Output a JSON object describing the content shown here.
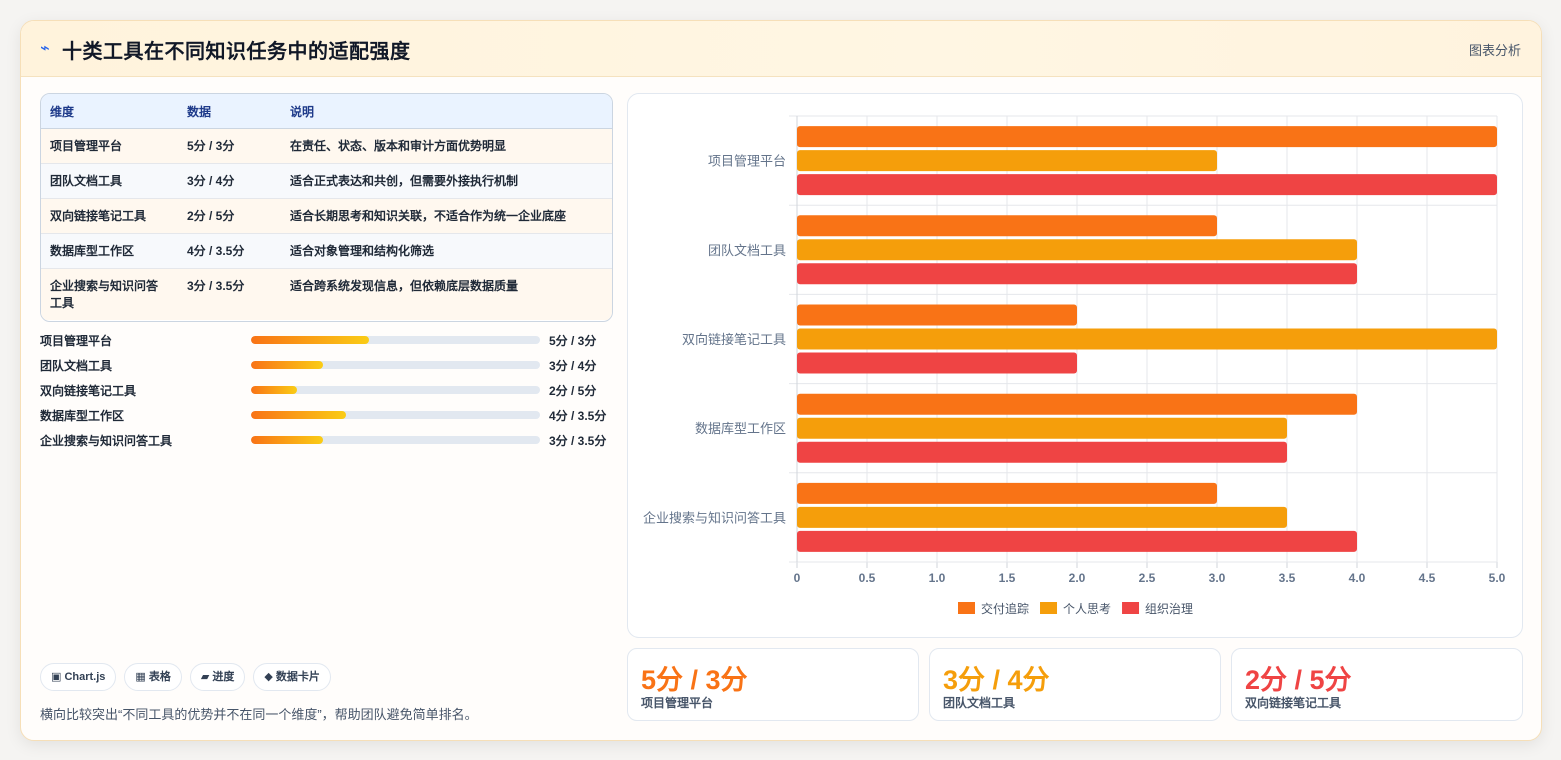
{
  "header": {
    "title_icon": "⌁",
    "title": "十类工具在不同知识任务中的适配强度",
    "action": "图表分析"
  },
  "table": {
    "headers": [
      "维度",
      "数据",
      "说明"
    ],
    "rows": [
      {
        "dimension": "项目管理平台",
        "data": "5分 / 3分",
        "note": "在责任、状态、版本和审计方面优势明显"
      },
      {
        "dimension": "团队文档工具",
        "data": "3分 / 4分",
        "note": "适合正式表达和共创，但需要外接执行机制"
      },
      {
        "dimension": "双向链接笔记工具",
        "data": "2分 / 5分",
        "note": "适合长期思考和知识关联，不适合作为统一企业底座"
      },
      {
        "dimension": "数据库型工作区",
        "data": "4分 / 3.5分",
        "note": "适合对象管理和结构化筛选"
      },
      {
        "dimension": "企业搜索与知识问答工具",
        "data": "3分 / 3.5分",
        "note": "适合跨系统发现信息，但依赖底层数据质量"
      }
    ]
  },
  "progress": [
    {
      "label": "项目管理平台",
      "value": "5分 / 3分",
      "level": 0.41
    },
    {
      "label": "团队文档工具",
      "value": "3分 / 4分",
      "level": 0.25
    },
    {
      "label": "双向链接笔记工具",
      "value": "2分 / 5分",
      "level": 0.16
    },
    {
      "label": "数据库型工作区",
      "value": "4分 / 3.5分",
      "level": 0.33
    },
    {
      "label": "企业搜索与知识问答工具",
      "value": "3分 / 3.5分",
      "level": 0.25
    }
  ],
  "chips": [
    {
      "icon": "chart-icon",
      "text": "▣ Chart.js"
    },
    {
      "icon": "table-icon",
      "text": "▦ 表格"
    },
    {
      "icon": "progress-icon",
      "text": "▰ 进度"
    },
    {
      "icon": "card-icon",
      "text": "◆ 数据卡片"
    }
  ],
  "footnote": "横向比较突出“不同工具的优势并不在同一个维度”，帮助团队避免简单排名。",
  "stats": [
    {
      "value": "5分 / 3分",
      "label": "项目管理平台",
      "color": "#f97316"
    },
    {
      "value": "3分 / 4分",
      "label": "团队文档工具",
      "color": "#f59e0b"
    },
    {
      "value": "2分 / 5分",
      "label": "双向链接笔记工具",
      "color": "#ef4444"
    }
  ],
  "chart_data": {
    "type": "bar",
    "orientation": "horizontal",
    "categories": [
      "项目管理平台",
      "团队文档工具",
      "双向链接笔记工具",
      "数据库型工作区",
      "企业搜索与知识问答工具"
    ],
    "series": [
      {
        "name": "交付追踪",
        "color": "#f97316",
        "values": [
          5,
          3,
          2,
          4,
          3
        ]
      },
      {
        "name": "个人思考",
        "color": "#f59e0b",
        "values": [
          3,
          4,
          5,
          3.5,
          3.5
        ]
      },
      {
        "name": "组织治理",
        "color": "#ef4444",
        "values": [
          5,
          4,
          2,
          3.5,
          4
        ]
      }
    ],
    "xlim": [
      0,
      5
    ],
    "xticks": [
      "0",
      "0.5",
      "1.0",
      "1.5",
      "2.0",
      "2.5",
      "3.0",
      "3.5",
      "4.0",
      "4.5",
      "5.0"
    ],
    "grid": true,
    "legend": "bottom"
  }
}
